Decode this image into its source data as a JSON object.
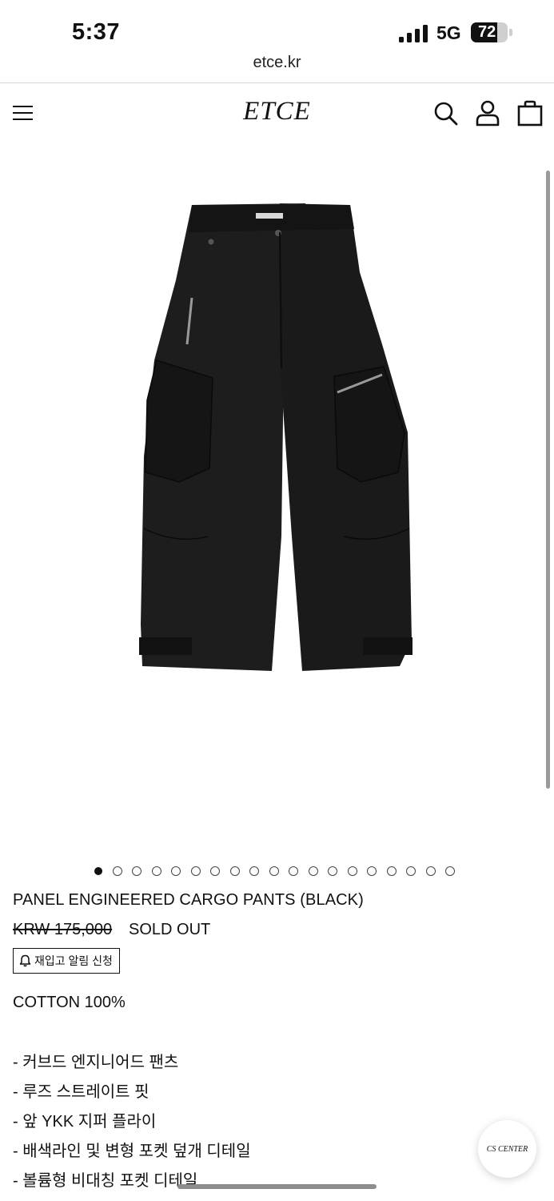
{
  "status_bar": {
    "time": "5:37",
    "network": "5G",
    "battery_percent": "72",
    "battery_level": 0.72
  },
  "browser": {
    "url": "etce.kr"
  },
  "header": {
    "logo": "ETCE",
    "icons": [
      "hamburger-menu-icon",
      "search-icon",
      "account-icon",
      "cart-bag-icon"
    ]
  },
  "gallery": {
    "image_alt": "black cargo pants",
    "total_slides": 19,
    "active_index": 0
  },
  "product": {
    "title": "PANEL ENGINEERED CARGO PANTS (BLACK)",
    "price": "KRW 175,000",
    "status": "SOLD OUT",
    "restock_button": "재입고 알림 신청",
    "material": "COTTON 100%",
    "features": [
      "- 커브드 엔지니어드 팬츠",
      "- 루즈 스트레이트 핏",
      "- 앞 YKK 지퍼 플라이",
      "- 배색라인 및 변형 포켓 덮개 디테일",
      "- 볼륨형 비대칭 포켓 디테일"
    ]
  },
  "floating": {
    "cs_label": "CS CENTER"
  },
  "colors": {
    "text": "#111111",
    "divider": "#d5d5d5",
    "background": "#ffffff"
  }
}
